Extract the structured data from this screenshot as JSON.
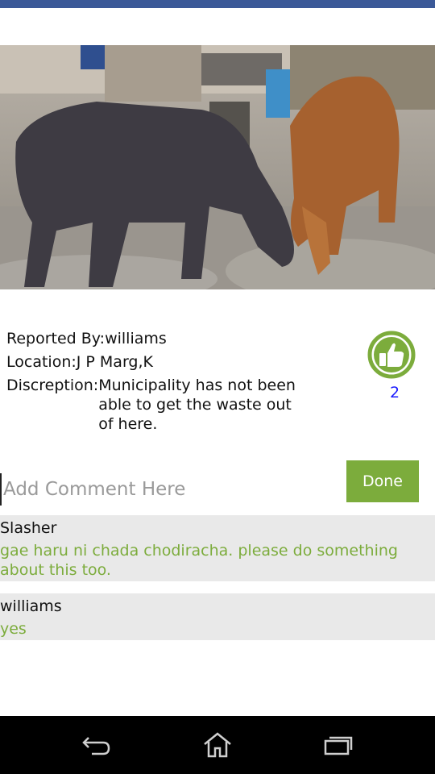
{
  "report": {
    "reported_by_label": "Reported By:",
    "reported_by": "williams",
    "location_label": "Location:",
    "location": "J P Marg,K",
    "description_label": "Discreption:",
    "description": "Municipality has not been able to get the waste out of here."
  },
  "likes": {
    "count": "2",
    "icon": "thumbs-up-icon",
    "color": "#7cac3c"
  },
  "comment_box": {
    "placeholder": "Add Comment Here",
    "value": "",
    "done_label": "Done"
  },
  "comments": [
    {
      "user": "Slasher",
      "text": "gae haru ni chada chodiracha. please do something about this too."
    },
    {
      "user": "williams",
      "text": "yes"
    }
  ],
  "colors": {
    "top_bar": "#3b5998",
    "accent": "#7cac3c",
    "comment_bg": "#e9e9e9",
    "like_count": "#1a1aff"
  },
  "nav": {
    "back_icon": "back-icon",
    "home_icon": "home-icon",
    "recents_icon": "recent-apps-icon"
  }
}
